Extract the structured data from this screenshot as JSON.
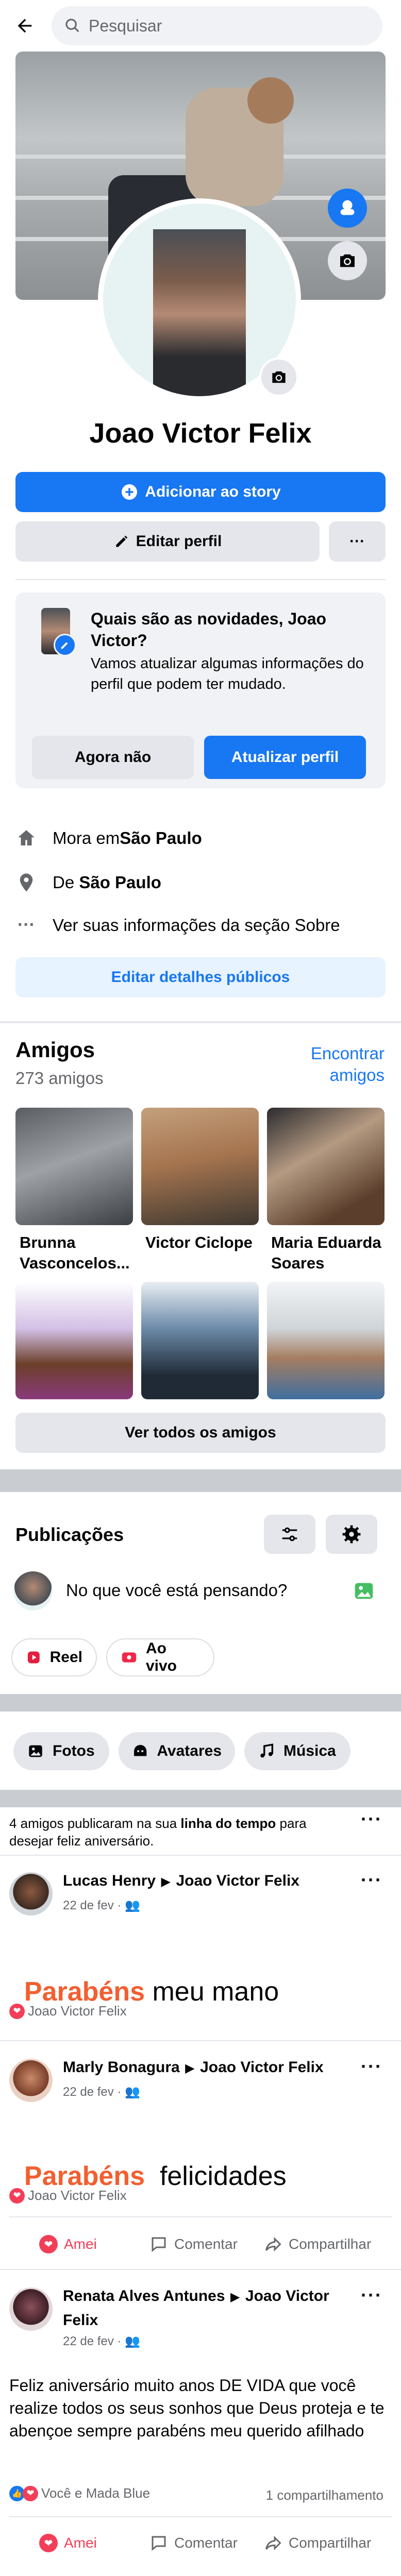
{
  "topbar": {
    "back_icon": "arrow-left-icon",
    "search_placeholder": "Pesquisar"
  },
  "profile": {
    "name": "Joao Victor Felix"
  },
  "actions": {
    "add_story": "Adicionar ao story",
    "edit_profile": "Editar perfil",
    "more": "···"
  },
  "news_card": {
    "title": "Quais são as novidades, Joao Victor?",
    "body": "Vamos atualizar algumas informações do perfil que podem ter mudado.",
    "not_now": "Agora não",
    "update": "Atualizar perfil"
  },
  "details": {
    "lives_prefix": "Mora em ",
    "lives_city": "São Paulo",
    "from_prefix": "De ",
    "from_city": "São Paulo",
    "see_about": "Ver suas informações da seção Sobre",
    "edit_public": "Editar detalhes públicos"
  },
  "friends": {
    "title": "Amigos",
    "count": "273 amigos",
    "find": "Encontrar amigos",
    "names": [
      "Brunna Vasconcelos...",
      "Victor Ciclope",
      "Maria Eduarda Soares",
      "",
      "",
      ""
    ],
    "see_all": "Ver todos os amigos"
  },
  "posts_section": {
    "title": "Publicações",
    "composer_placeholder": "No que você está pensando?",
    "reel": "Reel",
    "live": "Ao vivo",
    "chips": [
      "Fotos",
      "Avatares",
      "Música"
    ]
  },
  "birthday_notice": {
    "part1": "4 amigos publicaram na sua ",
    "bold": "linha do tempo",
    "part2": " para desejar feliz aniversário."
  },
  "posts": [
    {
      "author": "Lucas Henry",
      "target": "Joao Victor Felix",
      "date": "22 de fev · ",
      "highlight": "Parabéns",
      "rest": " meu mano",
      "reactions": "Joao Victor Felix"
    },
    {
      "author": "Marly Bonagura",
      "target": "Joao Victor Felix",
      "date": "22 de fev · ",
      "highlight": "Parabéns",
      "rest": "  felicidades",
      "reactions": "Joao Victor Felix",
      "like": "Amei",
      "comment": "Comentar",
      "share": "Compartilhar"
    },
    {
      "author": "Renata Alves Antunes",
      "target": "Joao Victor Felix",
      "date": "22 de fev · ",
      "body": "Feliz aniversário muito anos DE VIDA que você realize todos os seus sonhos que Deus proteja e te abençoe sempre parabéns meu querido afilhado",
      "reactions": "Você e Mada Blue",
      "shares": "1 compartilhamento",
      "like": "Amei",
      "comment": "Comentar",
      "share": "Compartilhar"
    }
  ]
}
